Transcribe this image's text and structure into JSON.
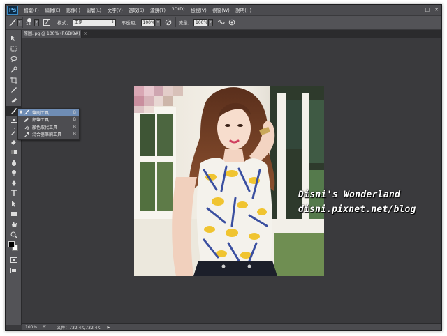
{
  "app": {
    "logo": "Ps"
  },
  "menu": [
    "檔案(F)",
    "編輯(E)",
    "影像(I)",
    "圖層(L)",
    "文字(Y)",
    "選取(S)",
    "濾鏡(T)",
    "3D(D)",
    "檢視(V)",
    "視窗(W)",
    "說明(H)"
  ],
  "window_controls": {
    "minimize": "—",
    "maximize": "□",
    "close": "✕"
  },
  "options": {
    "brush_size": "13",
    "mode_label": "模式：",
    "mode_value": "正常",
    "opacity_label": "不透明：",
    "opacity_value": "100%",
    "flow_label": "流量：",
    "flow_value": "100%"
  },
  "document": {
    "tab_title": "原圖.jpg @ 100% (RGB/8#)",
    "zoom": "100%",
    "doc_info": "文件：732.4K/732.4K"
  },
  "tools": [
    "move-icon",
    "marquee-icon",
    "lasso-icon",
    "quick-select-icon",
    "crop-icon",
    "eyedropper-icon",
    "healing-icon",
    "brush-icon",
    "stamp-icon",
    "history-brush-icon",
    "eraser-icon",
    "gradient-icon",
    "blur-icon",
    "dodge-icon",
    "pen-icon",
    "type-icon",
    "path-select-icon",
    "shape-icon",
    "hand-icon",
    "zoom-icon"
  ],
  "flyout": {
    "items": [
      {
        "label": "筆刷工具",
        "key": "B",
        "icon": "brush-icon",
        "selected": true
      },
      {
        "label": "鉛筆工具",
        "key": "B",
        "icon": "pencil-icon",
        "selected": false
      },
      {
        "label": "顏色取代工具",
        "key": "B",
        "icon": "color-replace-icon",
        "selected": false
      },
      {
        "label": "混合器筆刷工具",
        "key": "B",
        "icon": "mixer-brush-icon",
        "selected": false
      }
    ]
  },
  "watermark": {
    "line1": "Disni's Wonderland",
    "line2": "disni.pixnet.net/blog"
  },
  "colors": {
    "foreground": "#000000",
    "background": "#ffffff",
    "workspace": "#3a3a3d",
    "panel": "#535357",
    "highlight": "#6f8db5"
  }
}
